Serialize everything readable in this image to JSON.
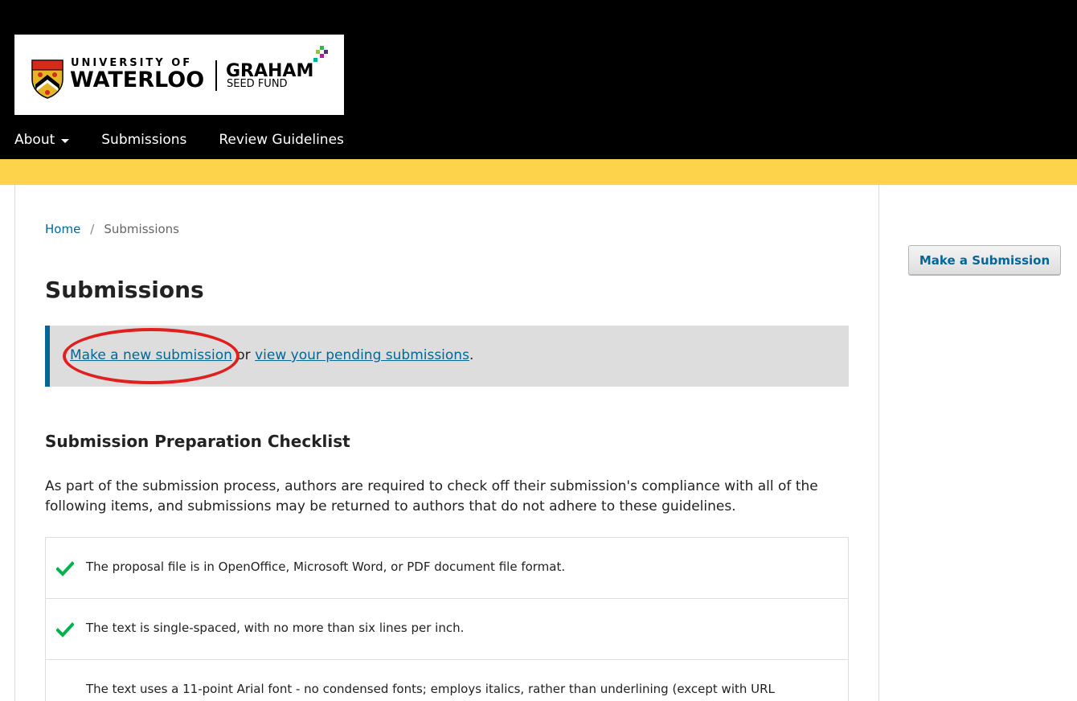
{
  "header": {
    "logo": {
      "university_top": "UNIVERSITY OF",
      "university_main": "WATERLOO",
      "fund_main": "GRAHAM",
      "fund_sub": "SEED FUND"
    },
    "nav": [
      {
        "label": "About",
        "has_dropdown": true
      },
      {
        "label": "Submissions"
      },
      {
        "label": "Review Guidelines"
      }
    ]
  },
  "breadcrumb": {
    "home": "Home",
    "separator": "/",
    "current": "Submissions"
  },
  "page": {
    "title": "Submissions",
    "notice": {
      "link1": "Make a new submission",
      "middle": " or ",
      "link2": "view your pending submissions",
      "end": "."
    },
    "checklist_title": "Submission Preparation Checklist",
    "intro": "As part of the submission process, authors are required to check off their submission's compliance with all of the following items, and submissions may be returned to authors that do not adhere to these guidelines.",
    "checklist": [
      {
        "text": "The proposal file is in OpenOffice, Microsoft Word, or PDF document file format.",
        "checked": true
      },
      {
        "text": "The text is single-spaced, with no more than six lines per inch.",
        "checked": true
      },
      {
        "text": "The text uses a 11-point Arial font - no condensed fonts; employs italics, rather than underlining (except with URL",
        "checked": false
      }
    ]
  },
  "sidebar": {
    "submit_button": "Make a Submission"
  },
  "colors": {
    "header_bg": "#000000",
    "accent_yellow": "#fed34c",
    "link": "#006798",
    "check_green": "#00b24e",
    "annotation_red": "#e0201e"
  }
}
